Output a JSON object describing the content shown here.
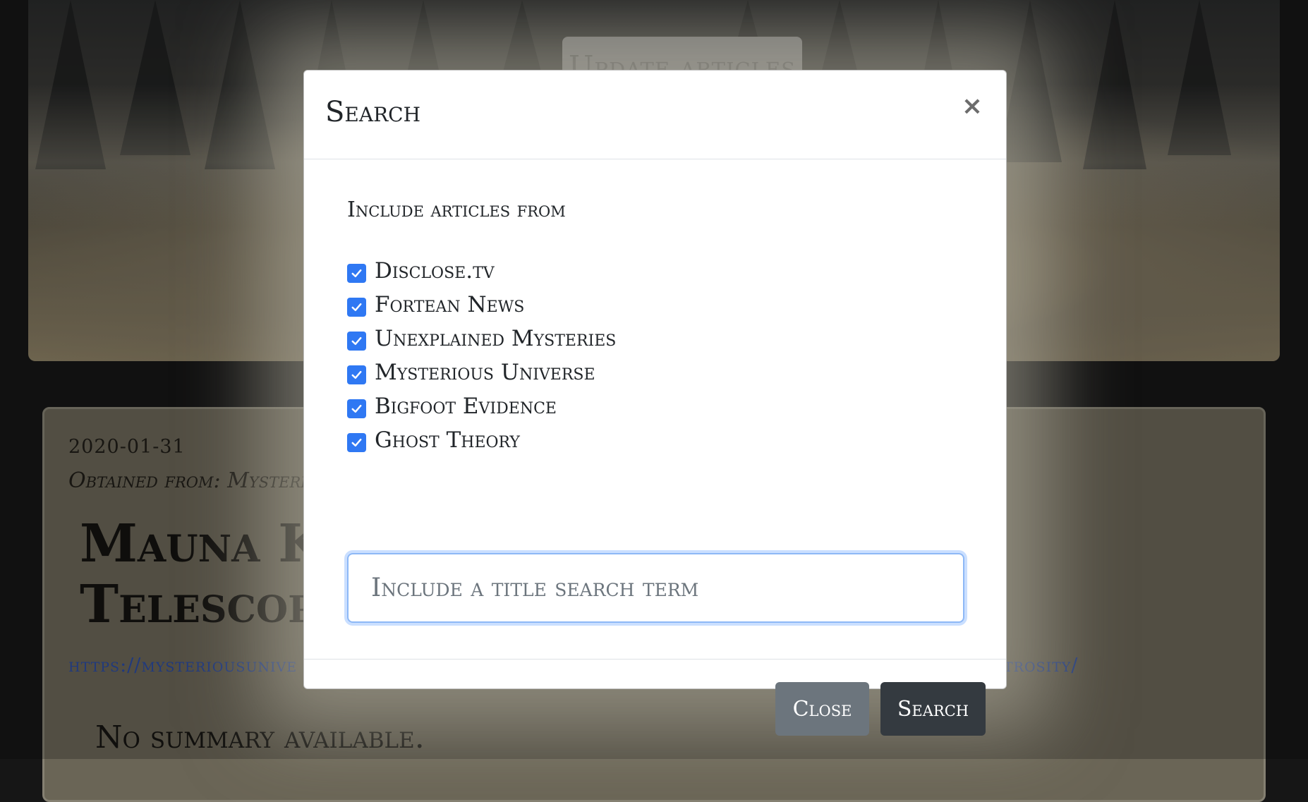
{
  "background": {
    "update_button_label": "Update articles",
    "article": {
      "date": "2020-01-31",
      "source_partial": "Obtained from: Mysteri",
      "title_partial_line1": "Mauna Ke",
      "title_partial_line2": "Telescopic",
      "link_partial_start": "https://mysteriousunive",
      "link_partial_end": "trosity/",
      "summary": "No summary available."
    }
  },
  "modal": {
    "title": "Search",
    "close_icon": "×",
    "include_label": "Include articles from",
    "sources": [
      {
        "label": "Disclose.tv",
        "checked": true
      },
      {
        "label": "Fortean News",
        "checked": true
      },
      {
        "label": "Unexplained Mysteries",
        "checked": true
      },
      {
        "label": "Mysterious Universe",
        "checked": true
      },
      {
        "label": "Bigfoot Evidence",
        "checked": true
      },
      {
        "label": "Ghost Theory",
        "checked": true
      }
    ],
    "search_placeholder": "Include a title search term",
    "search_value": "",
    "buttons": {
      "close": "Close",
      "search": "Search"
    }
  },
  "colors": {
    "checkbox": "#2f78f3",
    "close_button": "#6c757d",
    "search_button": "#343a40",
    "input_focus": "#8db8f6"
  }
}
